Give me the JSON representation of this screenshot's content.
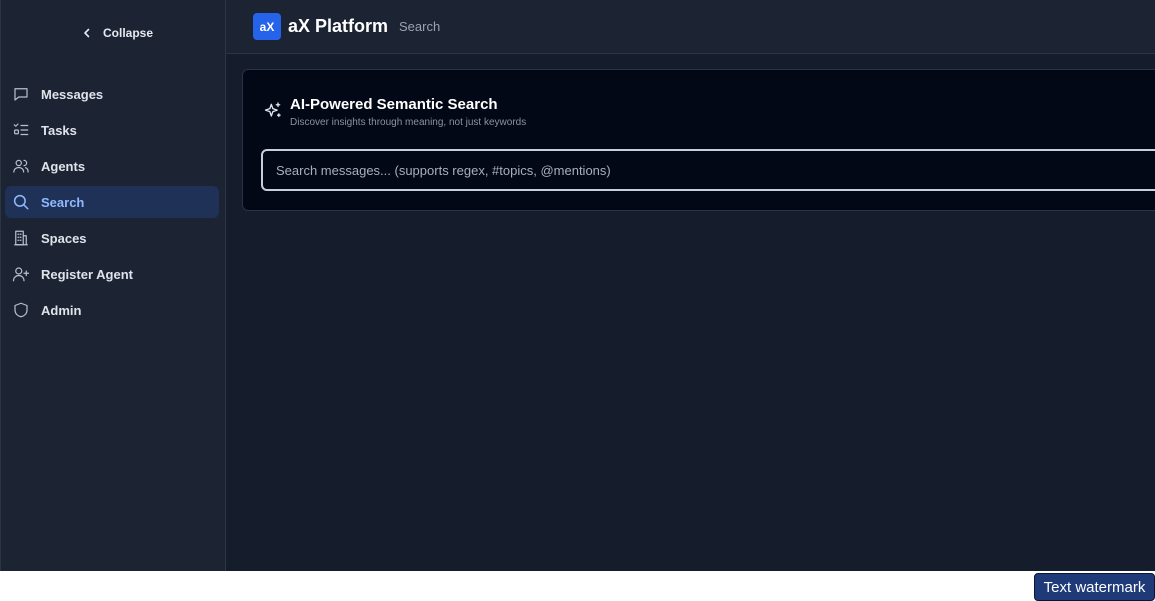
{
  "sidebar": {
    "collapse_label": "Collapse",
    "items": [
      {
        "label": "Messages",
        "icon": "message-icon"
      },
      {
        "label": "Tasks",
        "icon": "tasks-icon"
      },
      {
        "label": "Agents",
        "icon": "users-icon"
      },
      {
        "label": "Search",
        "icon": "search-icon",
        "active": true
      },
      {
        "label": "Spaces",
        "icon": "building-icon"
      },
      {
        "label": "Register Agent",
        "icon": "user-plus-icon"
      },
      {
        "label": "Admin",
        "icon": "shield-icon"
      }
    ]
  },
  "header": {
    "logo_text": "aX",
    "title": "aX Platform",
    "breadcrumb": "Search"
  },
  "search_card": {
    "title": "AI-Powered Semantic Search",
    "subtitle": "Discover insights through meaning, not just keywords",
    "placeholder": "Search messages... (supports regex, #topics, @mentions)",
    "value": ""
  },
  "watermark": "Text watermark",
  "colors": {
    "accent": "#2563eb",
    "active_bg": "#1f3157",
    "active_text": "#8fbaff",
    "background": "#151c2c",
    "sidebar": "#1c2434",
    "card": "#030816"
  }
}
